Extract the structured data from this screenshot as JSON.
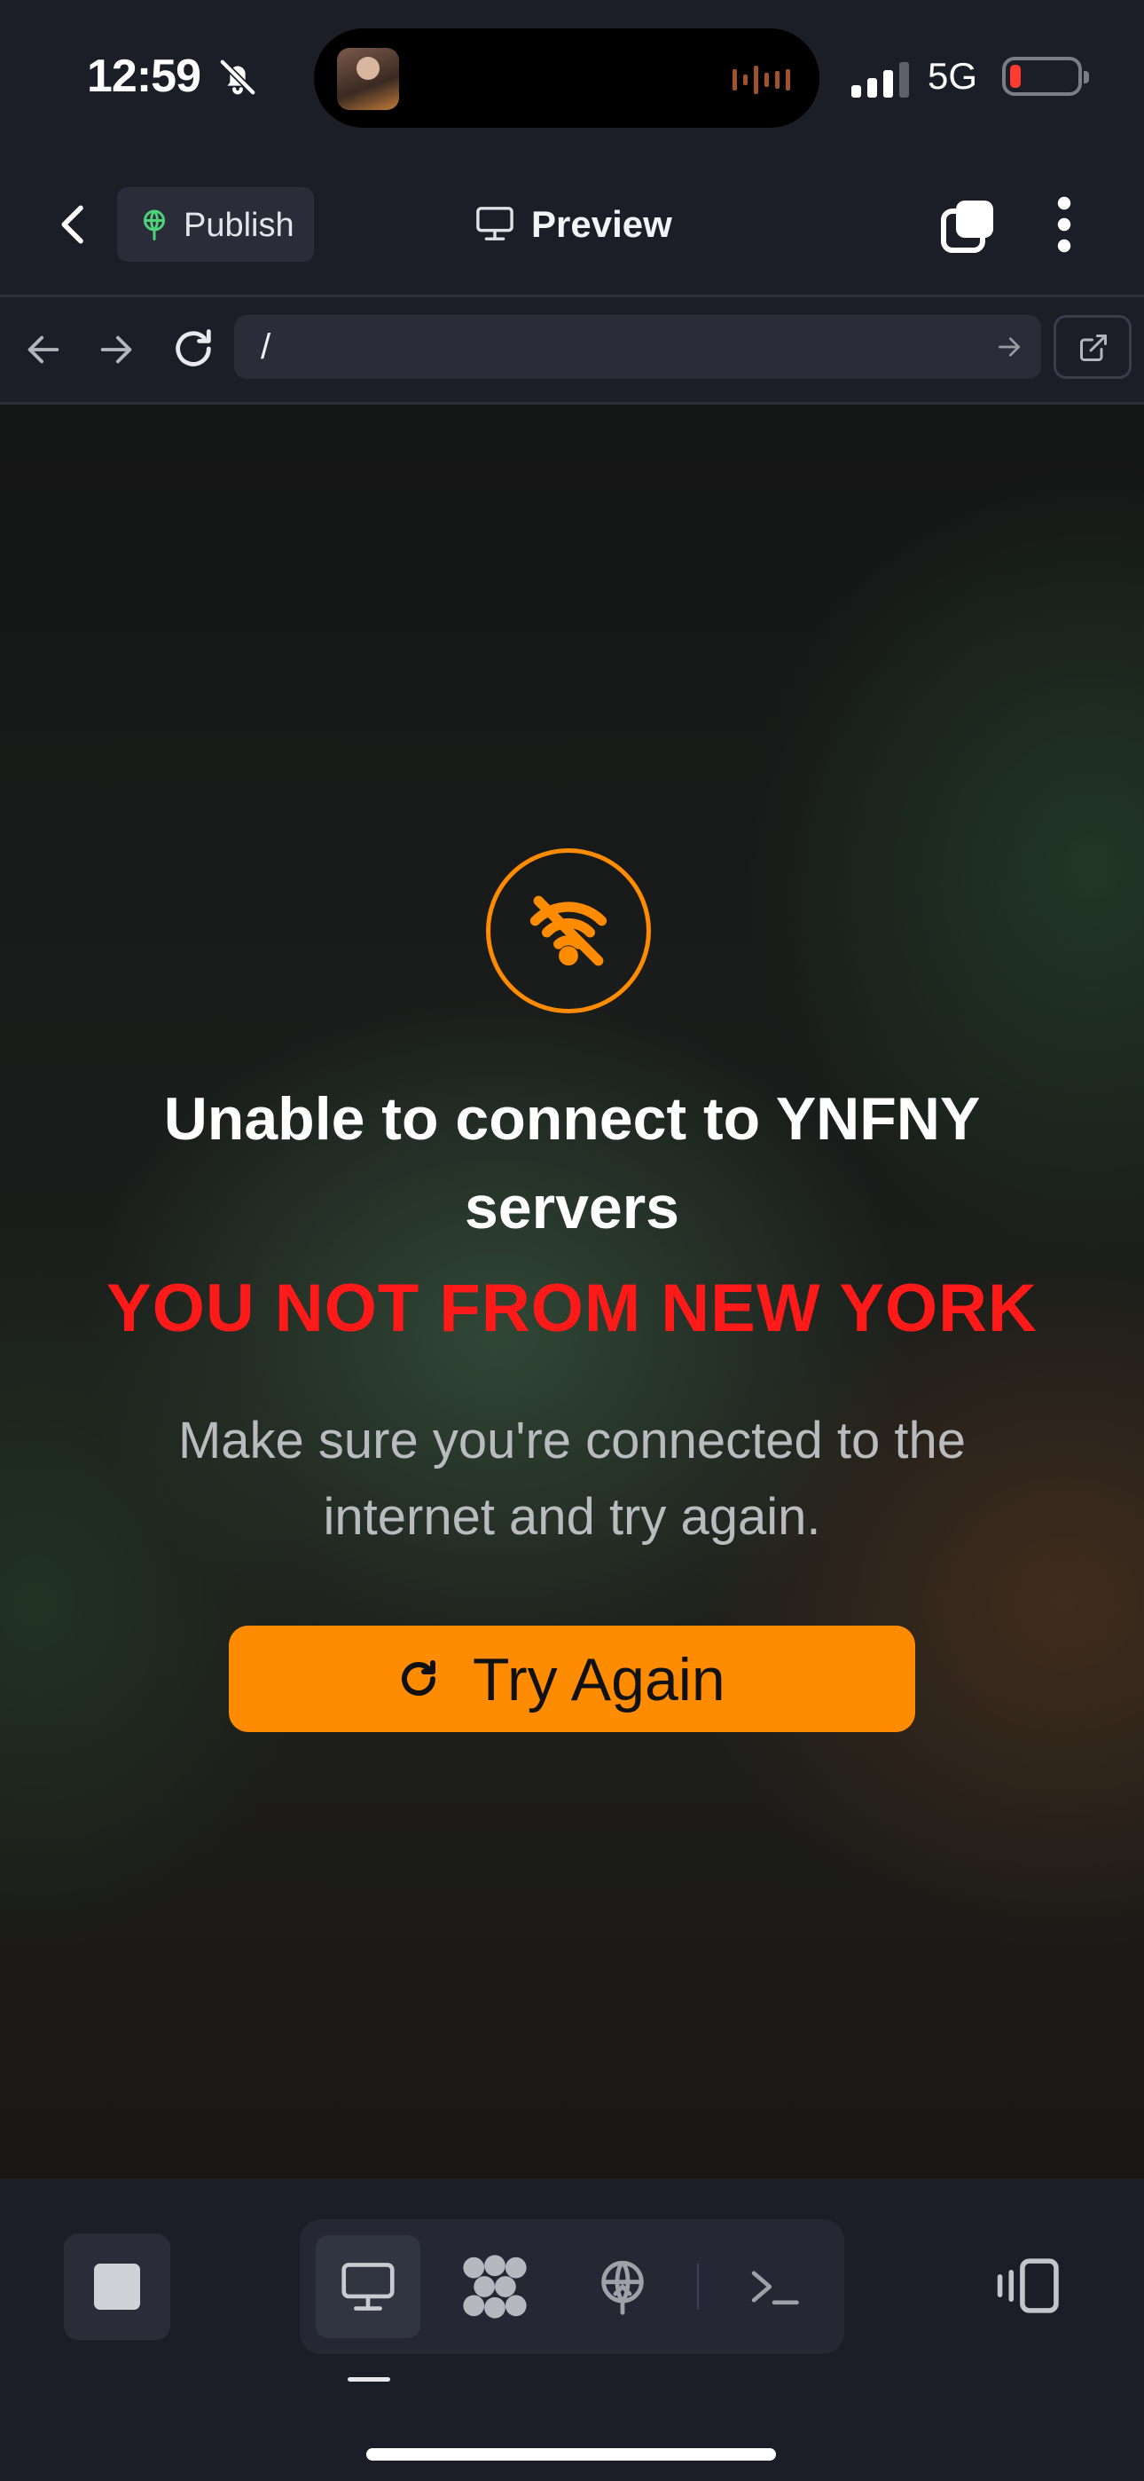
{
  "status_bar": {
    "time": "12:59",
    "network": "5G",
    "battery_color": "#ff3b30",
    "icons": [
      "bell-slash-icon",
      "signal-icon",
      "battery-icon"
    ]
  },
  "toolbar": {
    "publish_label": "Publish",
    "preview_label": "Preview",
    "icons": [
      "back-chevron-icon",
      "globe-icon",
      "monitor-icon",
      "tabs-icon",
      "more-vertical-icon"
    ]
  },
  "urlbar": {
    "url": "/",
    "icons": [
      "arrow-left-icon",
      "arrow-right-icon",
      "reload-icon",
      "go-arrow-icon",
      "external-link-icon"
    ]
  },
  "error": {
    "title": "Unable to connect to YNFNY servers",
    "warning": "YOU NOT FROM NEW YORK",
    "message": "Make sure you're connected to the internet and try again.",
    "retry_label": "Try Again",
    "accent": "#ff8c00",
    "warning_color": "#ff1a1a",
    "icons": [
      "wifi-off-icon",
      "refresh-icon"
    ]
  },
  "bottombar": {
    "icons": [
      "stop-icon",
      "monitor-icon",
      "sparkle-icon",
      "deploy-icon",
      "terminal-icon",
      "split-view-icon"
    ]
  }
}
